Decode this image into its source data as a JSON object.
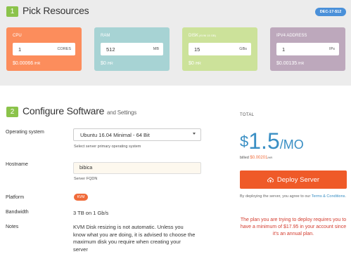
{
  "section1": {
    "step": "1",
    "title": "Pick Resources",
    "date_badge": "DEC-17-$12"
  },
  "cards": [
    {
      "label": "CPU",
      "label_sub": "",
      "value": "1",
      "unit": "CORES",
      "price": "$0.00066",
      "per": " /HR",
      "color": "#fc8d5c"
    },
    {
      "label": "RAM",
      "label_sub": "",
      "value": "512",
      "unit": "MB",
      "price": "$0",
      "per": " /HR",
      "color": "#a7d3d4"
    },
    {
      "label": "DISK",
      "label_sub": " (KVM 15 GB)",
      "value": "15",
      "unit": "GBs",
      "price": "$0",
      "per": " /HR",
      "color": "#cce29a"
    },
    {
      "label": "IPV4 ADDRESS",
      "label_sub": "",
      "value": "1",
      "unit": "IPs",
      "price": "$0.00135",
      "per": " /HR",
      "color": "#bda8bc"
    }
  ],
  "section2": {
    "step": "2",
    "title": "Configure Software",
    "subtitle": "and Settings"
  },
  "fields": {
    "os_label": "Operating system",
    "os_value": "Ubuntu 16.04 Minimal - 64 Bit",
    "os_hint": "Select server primary operating system",
    "hostname_label": "Hostname",
    "hostname_value": "bibica",
    "hostname_hint": "Server FQDN",
    "platform_label": "Platform",
    "platform_value": "KVM",
    "bandwidth_label": "Bandwidth",
    "bandwidth_value": "3 TB on 1 Gb/s",
    "notes_label": "Notes",
    "notes_value": "KVM Disk resizing is not automatic. Unless you know what you are doing, it is advised to choose the maximum disk you require when creating your server"
  },
  "total": {
    "label": "TOTAL",
    "dollar": "$",
    "amount": "1.5",
    "per": "/MO",
    "billed_prefix": "billed ",
    "billed_amount": "$0.00201",
    "billed_per": "/HR",
    "deploy_label": "Deploy Server",
    "terms_prefix": "By deploying the server, you agree to our ",
    "terms_link": "Terms & Conditions",
    "terms_suffix": ".",
    "warning": "The plan you are trying to deploy requires you to have a minimum of $17.95 in your account since it's an annual plan."
  }
}
